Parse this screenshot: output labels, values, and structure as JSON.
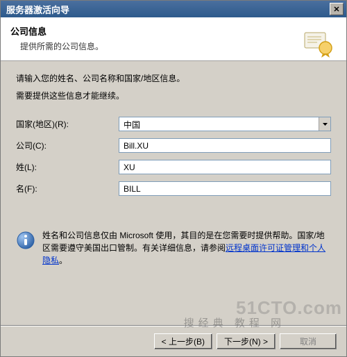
{
  "window": {
    "title": "服务器激活向导"
  },
  "header": {
    "title": "公司信息",
    "subtitle": "提供所需的公司信息。"
  },
  "instructions": {
    "line1": "请输入您的姓名、公司名称和国家/地区信息。",
    "line2": "需要提供这些信息才能继续。"
  },
  "form": {
    "country": {
      "label": "国家(地区)(R):",
      "value": "中国"
    },
    "company": {
      "label": "公司(C):",
      "value": "Bill.XU"
    },
    "lastname": {
      "label": "姓(L):",
      "value": "XU"
    },
    "firstname": {
      "label": "名(F):",
      "value": "BILL"
    }
  },
  "info": {
    "text_before_link": "姓名和公司信息仅由 Microsoft 使用，其目的是在您需要时提供帮助。国家/地区需要遵守美国出口管制。有关详细信息，请参阅",
    "link_text": "远程桌面许可证管理和个人隐私",
    "text_after_link": "。"
  },
  "buttons": {
    "back": "< 上一步(B)",
    "next": "下一步(N) >",
    "cancel": "取消"
  },
  "watermarks": {
    "w1": "51CTO.com",
    "w2": "搜经典 教程 网"
  }
}
